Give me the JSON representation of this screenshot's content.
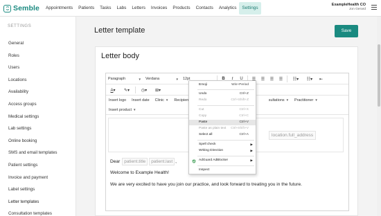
{
  "brand": {
    "name": "Semble",
    "accent": "#1a8a80"
  },
  "nav": {
    "items": [
      "Appointments",
      "Patients",
      "Tasks",
      "Labs",
      "Letters",
      "Invoices",
      "Products",
      "Contacts",
      "Analytics",
      "Settings"
    ],
    "active": "Settings"
  },
  "account": {
    "org": "ExampleHealth CO",
    "user": "Jon Gerard"
  },
  "sidebar": {
    "heading": "SETTINGS",
    "items": [
      "General",
      "Roles",
      "Users",
      "Locations",
      "Availability",
      "Access groups",
      "Medical settings",
      "Lab settings",
      "Online booking",
      "SMS and email templates",
      "Patient settings",
      "Invoice and payment",
      "Label settings",
      "Letter templates",
      "Consultation templates"
    ]
  },
  "page": {
    "title": "Letter template",
    "save_label": "Save"
  },
  "card": {
    "title": "Letter body"
  },
  "toolbar": {
    "format": "Paragraph",
    "font": "Verdana",
    "size": "12pt",
    "insert_logo": "Insert logo",
    "insert_date": "Insert date",
    "clinic": "Clinic",
    "recipient": "Recipient",
    "consultations": "sultations",
    "practitioner": "Practitioner",
    "insert_product": "Insert product"
  },
  "document": {
    "location_token": "location.full_address",
    "dear": "Dear",
    "title_token": "patient.title",
    "last_token": "patient.last",
    "comma": ",",
    "welcome": "Welcome to Example Health!",
    "body": "We are very excited to have you join our practice, and look forward to treating you in the future."
  },
  "context_menu": {
    "items": [
      {
        "label": "Emoji",
        "shortcut": "Win+Period",
        "disabled": false
      },
      {
        "label": "Undo",
        "shortcut": "Ctrl+Z",
        "disabled": false
      },
      {
        "label": "Redo",
        "shortcut": "Ctrl+Shift+Z",
        "disabled": true
      },
      {
        "label": "Cut",
        "shortcut": "Ctrl+X",
        "disabled": true
      },
      {
        "label": "Copy",
        "shortcut": "Ctrl+C",
        "disabled": true
      },
      {
        "label": "Paste",
        "shortcut": "Ctrl+V",
        "disabled": false
      },
      {
        "label": "Paste as plain text",
        "shortcut": "Ctrl+Shift+V",
        "disabled": true
      },
      {
        "label": "Select all",
        "shortcut": "Ctrl+A",
        "disabled": false
      },
      {
        "label": "Spell check",
        "shortcut": "",
        "disabled": false
      },
      {
        "label": "Writing Direction",
        "shortcut": "",
        "disabled": false
      },
      {
        "label": "AdGuard AdBlocker",
        "shortcut": "",
        "disabled": false
      },
      {
        "label": "Inspect",
        "shortcut": "",
        "disabled": false
      }
    ],
    "highlighted": "Paste"
  }
}
